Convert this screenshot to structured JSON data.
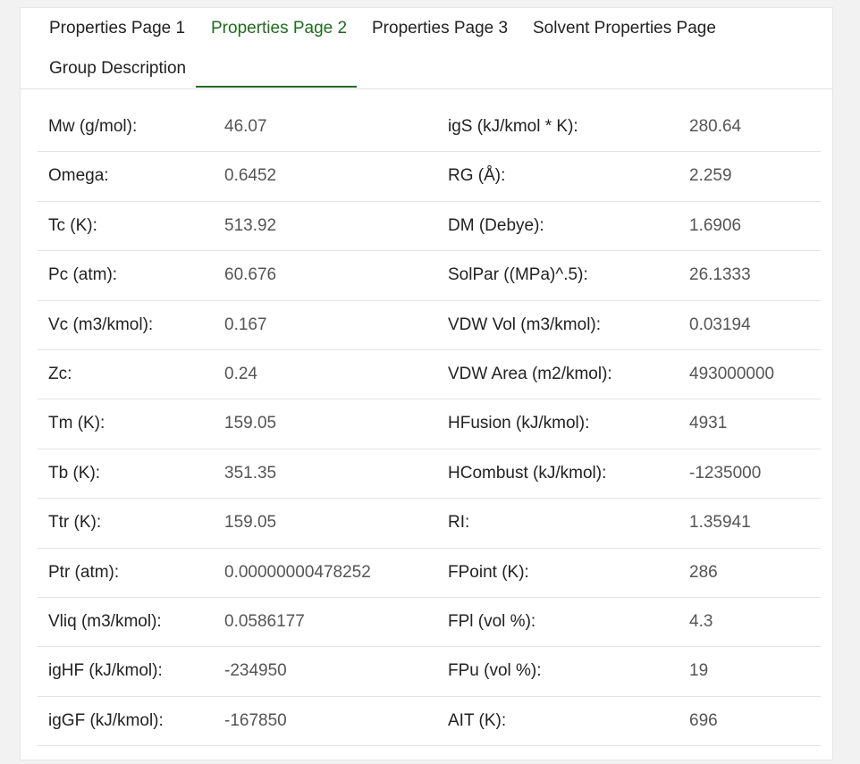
{
  "tabs": [
    {
      "label": "Properties Page 1"
    },
    {
      "label": "Properties Page 2"
    },
    {
      "label": "Properties Page 3"
    },
    {
      "label": "Solvent Properties Page"
    },
    {
      "label": "Group Description"
    }
  ],
  "active_tab": "Properties Page 2",
  "colors": {
    "accent": "#1f6b1f"
  },
  "rows": [
    {
      "l1": "Mw (g/mol):",
      "v1": "46.07",
      "l2": "igS (kJ/kmol * K):",
      "v2": "280.64"
    },
    {
      "l1": "Omega:",
      "v1": "0.6452",
      "l2": "RG (Å):",
      "v2": "2.259"
    },
    {
      "l1": "Tc (K):",
      "v1": "513.92",
      "l2": "DM (Debye):",
      "v2": "1.6906"
    },
    {
      "l1": "Pc (atm):",
      "v1": "60.676",
      "l2": "SolPar ((MPa)^.5):",
      "v2": "26.1333"
    },
    {
      "l1": "Vc (m3/kmol):",
      "v1": "0.167",
      "l2": "VDW Vol (m3/kmol):",
      "v2": "0.03194"
    },
    {
      "l1": "Zc:",
      "v1": "0.24",
      "l2": "VDW Area (m2/kmol):",
      "v2": "493000000"
    },
    {
      "l1": "Tm (K):",
      "v1": "159.05",
      "l2": "HFusion (kJ/kmol):",
      "v2": "4931"
    },
    {
      "l1": "Tb (K):",
      "v1": "351.35",
      "l2": "HCombust (kJ/kmol):",
      "v2": "-1235000"
    },
    {
      "l1": "Ttr (K):",
      "v1": "159.05",
      "l2": "RI:",
      "v2": "1.35941"
    },
    {
      "l1": "Ptr (atm):",
      "v1": "0.00000000478252",
      "l2": "FPoint (K):",
      "v2": "286"
    },
    {
      "l1": "Vliq (m3/kmol):",
      "v1": "0.0586177",
      "l2": "FPl (vol %):",
      "v2": "4.3"
    },
    {
      "l1": "igHF (kJ/kmol):",
      "v1": "-234950",
      "l2": "FPu (vol %):",
      "v2": "19"
    },
    {
      "l1": "igGF (kJ/kmol):",
      "v1": "-167850",
      "l2": "AIT (K):",
      "v2": "696"
    }
  ]
}
